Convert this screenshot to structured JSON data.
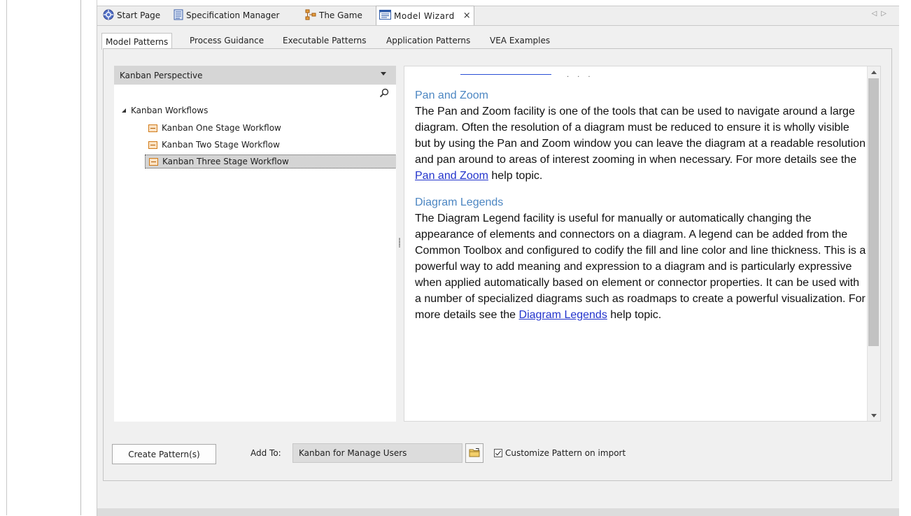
{
  "doc_tabs": [
    {
      "label": "Start Page",
      "icon": "start-page-icon"
    },
    {
      "label": "Specification Manager",
      "icon": "specification-icon"
    },
    {
      "label": "The Game",
      "icon": "diagram-icon"
    },
    {
      "label": "Model Wizard",
      "icon": "model-wizard-icon",
      "active": true
    }
  ],
  "doc_tab_close": "×",
  "page_tabs": [
    {
      "label": "Model Patterns",
      "active": true
    },
    {
      "label": "Process Guidance"
    },
    {
      "label": "Executable Patterns"
    },
    {
      "label": "Application Patterns"
    },
    {
      "label": "VEA Examples"
    }
  ],
  "tree": {
    "perspective": "Kanban Perspective",
    "root": "Kanban Workflows",
    "items": [
      {
        "label": "Kanban One Stage Workflow"
      },
      {
        "label": "Kanban Two Stage Workflow"
      },
      {
        "label": "Kanban Three Stage Workflow",
        "selected": true
      }
    ]
  },
  "description": {
    "sections": [
      {
        "title": "Pan and Zoom",
        "body": "The Pan and Zoom facility is one of the tools that can be used to navigate around a large diagram. Often the resolution of a diagram must be reduced to ensure it is wholly visible but by using the Pan and Zoom window you can leave the diagram at a readable resolution and pan around to areas of interest zooming in when necessary. For more details see the ",
        "link": "Pan and Zoom",
        "tail": " help topic."
      },
      {
        "title": "Diagram Legends",
        "body": "The Diagram Legend facility is useful for manually or automatically changing the appearance of elements and connectors on a diagram. A legend can be added from the Common Toolbox and configured to codify the fill and line color and line thickness. This is a powerful way to add meaning and expression to a diagram and is particularly expressive when applied automatically based on element or connector properties. It can be used with a number of specialized diagrams such as roadmaps to create a powerful visualization.  For more details see the ",
        "link": "Diagram Legends",
        "tail": " help topic."
      }
    ]
  },
  "footer": {
    "create_button": "Create Pattern(s)",
    "add_to_label": "Add To:",
    "add_to_value": "Kanban for Manage Users",
    "customize_label": "Customize Pattern on import",
    "customize_checked": true
  },
  "colors": {
    "section_title": "#4c86c2",
    "link": "#2233cc",
    "icon_orange": "#d07a18"
  }
}
